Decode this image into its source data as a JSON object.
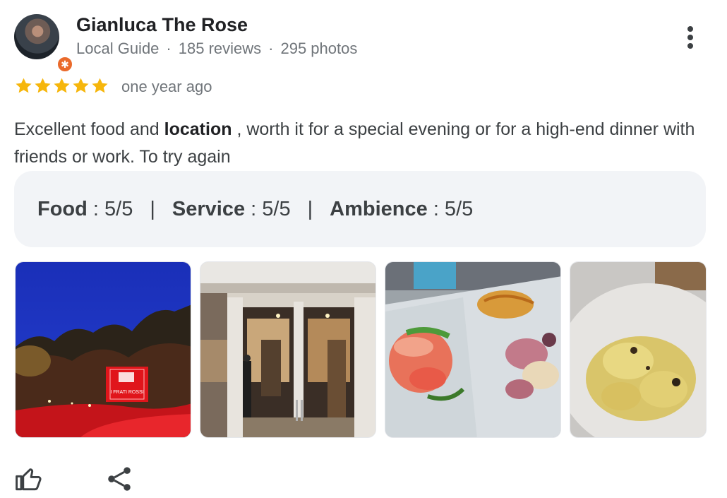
{
  "reviewer": {
    "name": "Gianluca The Rose",
    "role": "Local Guide",
    "reviews": "185 reviews",
    "photos": "295 photos",
    "separator": "·"
  },
  "review": {
    "stars": 5,
    "max_stars": 5,
    "date": "one year ago",
    "text_before": "Excellent food and ",
    "text_bold": "location",
    "text_after": " , worth it for a special evening or for a high-end dinner with friends or work. To try again"
  },
  "ratings": [
    {
      "label": "Food",
      "value": " : 5/5"
    },
    {
      "label": "Service",
      "value": " : 5/5"
    },
    {
      "label": "Ambience",
      "value": " : 5/5"
    }
  ],
  "ratings_separator": "|",
  "photo_sign_text": "I FRATI ROSSI",
  "colors": {
    "star": "#f6b60c",
    "badge": "#ea6a2b",
    "secondary_text": "#70757a",
    "panel_bg": "#f2f4f7"
  },
  "icons": [
    "more-vert-icon",
    "star-icon",
    "thumb-up-icon",
    "share-icon",
    "local-guide-badge-icon"
  ]
}
